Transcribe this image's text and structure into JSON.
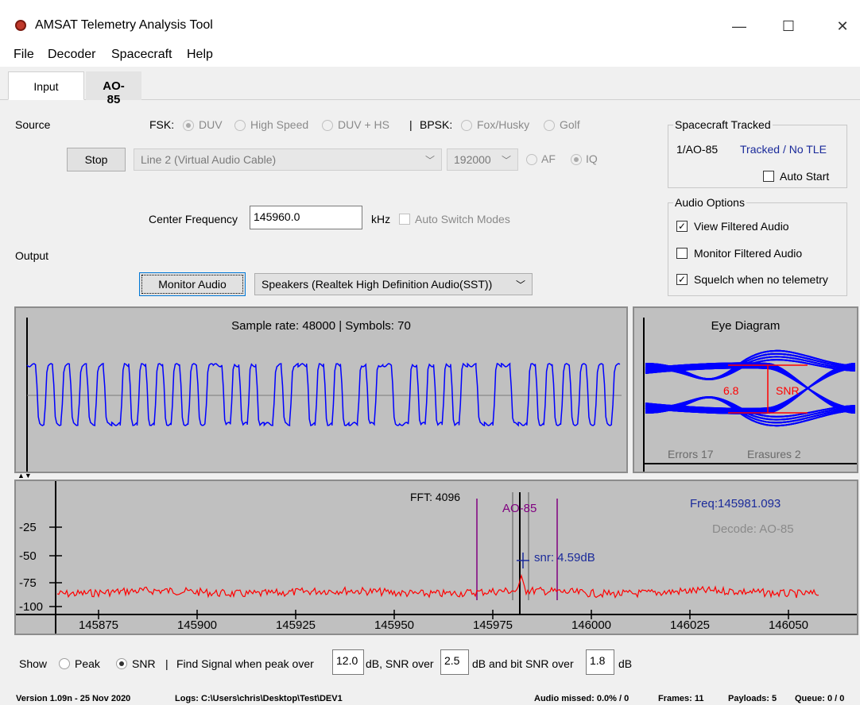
{
  "window": {
    "title": "AMSAT Telemetry Analysis Tool",
    "min": "—",
    "max": "☐",
    "close": "✕"
  },
  "menu": [
    "File",
    "Decoder",
    "Spacecraft",
    "Help"
  ],
  "tabs": [
    "Input",
    "AO-85"
  ],
  "source": {
    "label": "Source",
    "fsk_label": "FSK:",
    "fsk_options": [
      "DUV",
      "High Speed",
      "DUV + HS"
    ],
    "separator": "|",
    "bpsk_label": "BPSK:",
    "bpsk_options": [
      "Fox/Husky",
      "Golf"
    ],
    "stop_button": "Stop",
    "device": "Line 2 (Virtual Audio Cable)",
    "rate": "192000",
    "af": "AF",
    "iq": "IQ",
    "center_freq_label": "Center Frequency",
    "center_freq_value": "145960.0",
    "center_freq_unit": "kHz",
    "auto_switch": "Auto Switch Modes"
  },
  "output": {
    "label": "Output",
    "monitor_button": "Monitor Audio",
    "speaker": "Speakers (Realtek High Definition Audio(SST))"
  },
  "spacecraft": {
    "title": "Spacecraft Tracked",
    "name": "1/AO-85",
    "status": "Tracked / No TLE",
    "auto_start": "Auto Start"
  },
  "audio_options": {
    "title": "Audio Options",
    "items": [
      {
        "label": "View Filtered Audio",
        "checked": true
      },
      {
        "label": "Monitor Filtered Audio",
        "checked": false
      },
      {
        "label": "Squelch when no telemetry",
        "checked": true
      }
    ]
  },
  "waveform": {
    "header": "Sample rate: 48000 | Symbols: 70",
    "line_color": "#0000ff"
  },
  "eye": {
    "title": "Eye Diagram",
    "snr_value": "6.8",
    "snr_label": "SNR",
    "errors": "Errors 17",
    "erasures": "Erasures 2"
  },
  "fft": {
    "header": "FFT: 4096",
    "sat_label": "AO-85",
    "freq": "Freq:145981.093",
    "decode": "Decode: AO-85",
    "snr": "snr: 4.59dB",
    "y_ticks": [
      "-25",
      "-50",
      "-75",
      "-100"
    ],
    "x_ticks": [
      "145875",
      "145900",
      "145925",
      "145950",
      "145975",
      "146000",
      "146025",
      "146050"
    ],
    "trace_color": "#ff0000"
  },
  "find_signal": {
    "show": "Show",
    "peak": "Peak",
    "snr": "SNR",
    "sep": "|",
    "text1": "Find Signal when peak over",
    "peak_val": "12.0",
    "text2": "dB, SNR over",
    "snr_val": "2.5",
    "text3": "dB and bit SNR over",
    "bit_val": "1.8",
    "text4": "dB"
  },
  "status": {
    "version": "Version 1.09n - 25 Nov 2020",
    "logs": "Logs: C:\\Users\\chris\\Desktop\\Test\\DEV1",
    "audio_missed": "Audio missed: 0.0% / 0",
    "frames": "Frames: 11",
    "payloads": "Payloads: 5",
    "queue": "Queue: 0 / 0"
  }
}
